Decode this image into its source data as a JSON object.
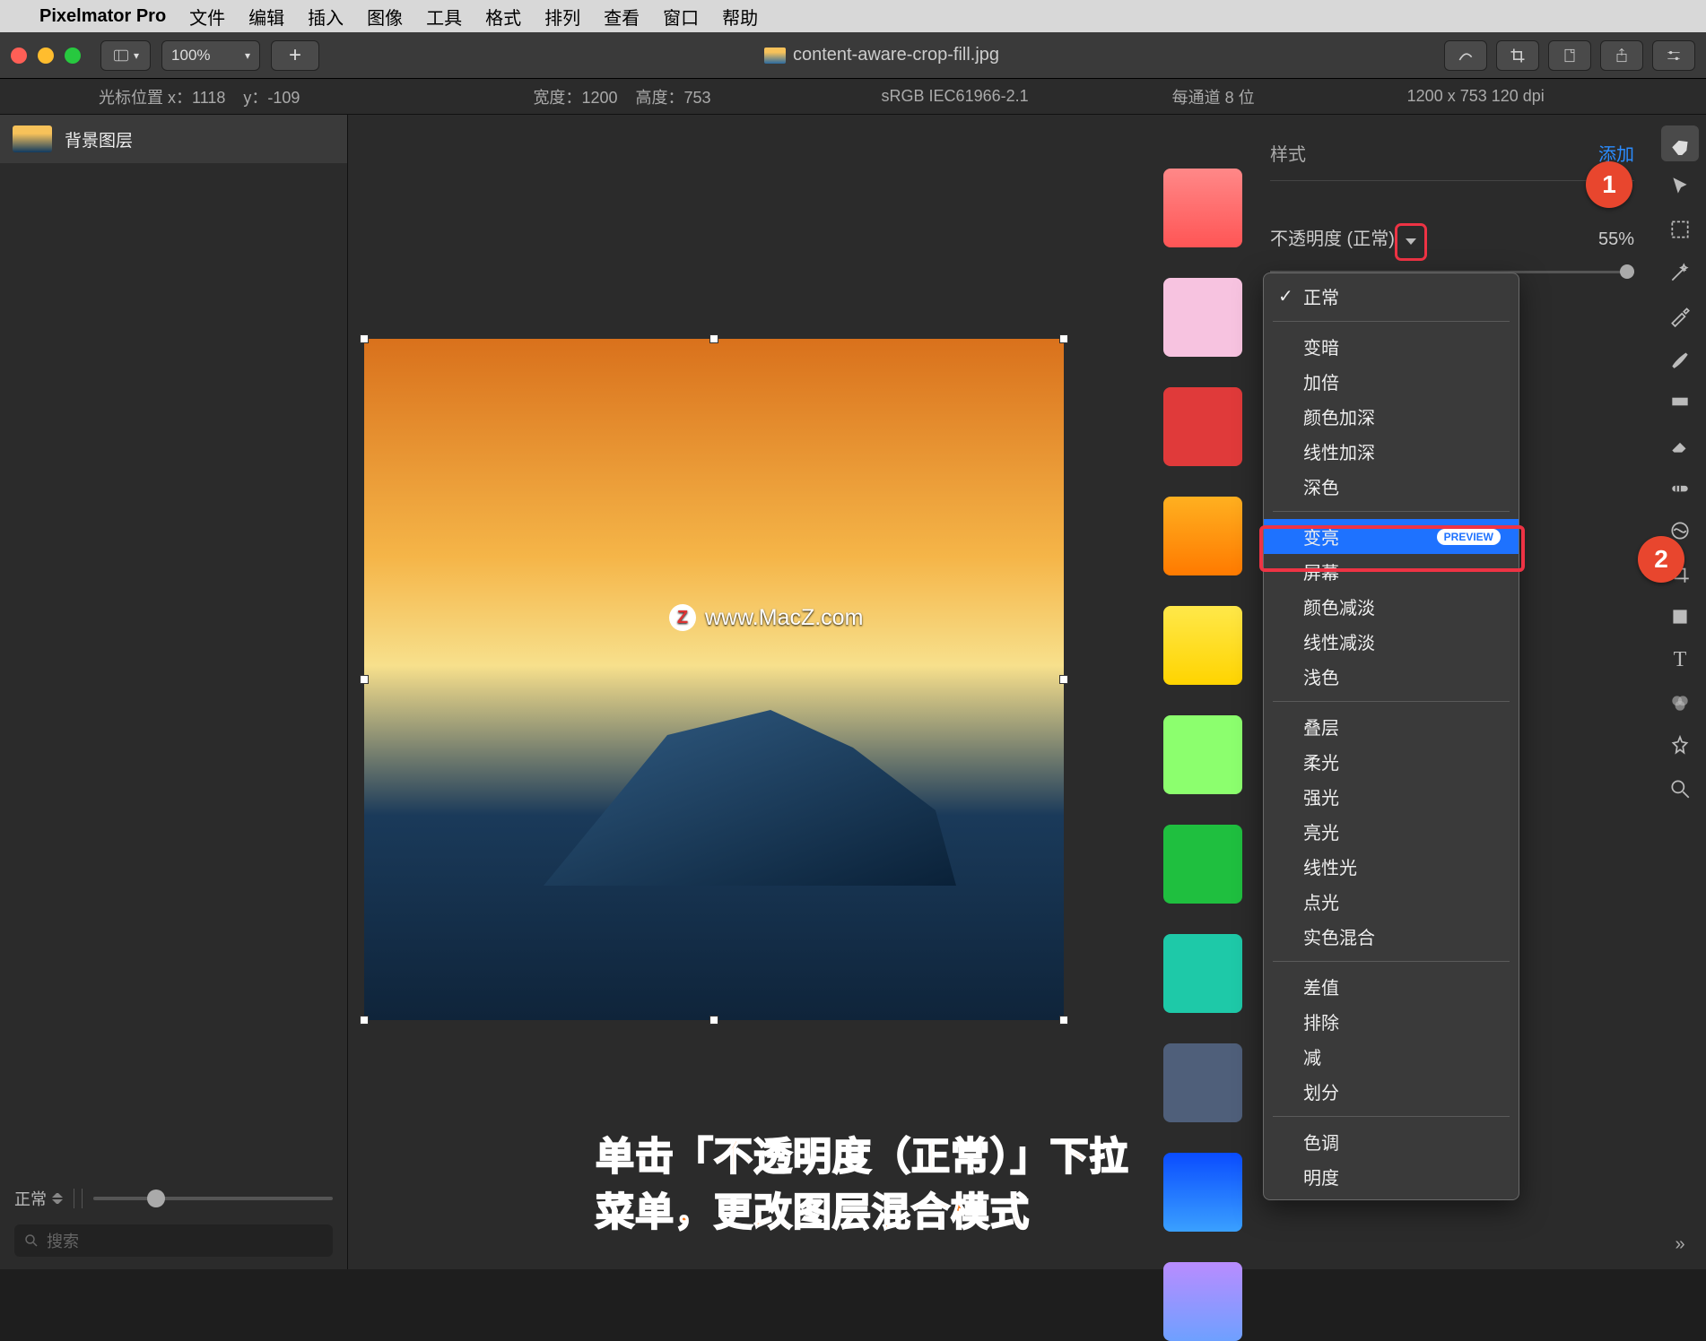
{
  "menubar": {
    "app": "Pixelmator Pro",
    "items": [
      "文件",
      "编辑",
      "插入",
      "图像",
      "工具",
      "格式",
      "排列",
      "查看",
      "窗口",
      "帮助"
    ]
  },
  "toolbar": {
    "zoom": "100%",
    "title": "content-aware-crop-fill.jpg"
  },
  "infobar": {
    "cursor_label": "光标位置 x：",
    "cursor_x": "1118",
    "cursor_y_label": "y：",
    "cursor_y": "-109",
    "width_label": "宽度：",
    "width": "1200",
    "height_label": "高度：",
    "height": "753",
    "colorspace": "sRGB IEC61966-2.1",
    "channel": "每通道 8 位",
    "size": "1200 x 753 120 dpi"
  },
  "layers": {
    "layer_name": "背景图层",
    "blend": "正常",
    "search_placeholder": "搜索"
  },
  "rightpanel": {
    "style_label": "样式",
    "add_label": "添加",
    "opacity_label": "不透明度 (正常)",
    "opacity_value": "55%"
  },
  "swatches": [
    "linear-gradient(180deg,#f88,#f55)",
    "linear-gradient(180deg,#f7c3e0,#f7c3e0)",
    "linear-gradient(180deg,#e03a3a,#e03a3a)",
    "linear-gradient(180deg,#ffb020,#ff7a00)",
    "linear-gradient(180deg,#ffe84a,#ffd400)",
    "linear-gradient(180deg,#8cff6e,#8cff6e)",
    "linear-gradient(180deg,#1fbf3f,#1fbf3f)",
    "linear-gradient(180deg,#1ec9a8,#1ec9a8)",
    "linear-gradient(180deg,#4f5f7a,#4f5f7a)",
    "linear-gradient(180deg,#0a4cff,#3aa0ff)",
    "linear-gradient(180deg,#b98cff,#6ea0ff)"
  ],
  "dropdown": {
    "groups": [
      [
        {
          "label": "正常",
          "checked": true
        }
      ],
      [
        {
          "label": "变暗"
        },
        {
          "label": "加倍"
        },
        {
          "label": "颜色加深"
        },
        {
          "label": "线性加深"
        },
        {
          "label": "深色"
        }
      ],
      [
        {
          "label": "变亮",
          "selected": true,
          "preview": "PREVIEW"
        },
        {
          "label": "屏幕"
        },
        {
          "label": "颜色减淡"
        },
        {
          "label": "线性减淡"
        },
        {
          "label": "浅色"
        }
      ],
      [
        {
          "label": "叠层"
        },
        {
          "label": "柔光"
        },
        {
          "label": "强光"
        },
        {
          "label": "亮光"
        },
        {
          "label": "线性光"
        },
        {
          "label": "点光"
        },
        {
          "label": "实色混合"
        }
      ],
      [
        {
          "label": "差值"
        },
        {
          "label": "排除"
        },
        {
          "label": "减"
        },
        {
          "label": "划分"
        }
      ],
      [
        {
          "label": "色调"
        },
        {
          "label": "明度"
        }
      ]
    ]
  },
  "markers": {
    "m1": "1",
    "m2": "2"
  },
  "watermark": "www.MacZ.com",
  "watermark_badge": "Z",
  "caption": "单击「不透明度（正常）」下拉菜单，更改图层混合模式",
  "tools": [
    "styles",
    "arrow",
    "marquee",
    "magic",
    "eyedropper",
    "brush",
    "gradient",
    "eraser",
    "repair",
    "warp",
    "crop",
    "shape",
    "type",
    "channel",
    "effects",
    "zoom"
  ]
}
